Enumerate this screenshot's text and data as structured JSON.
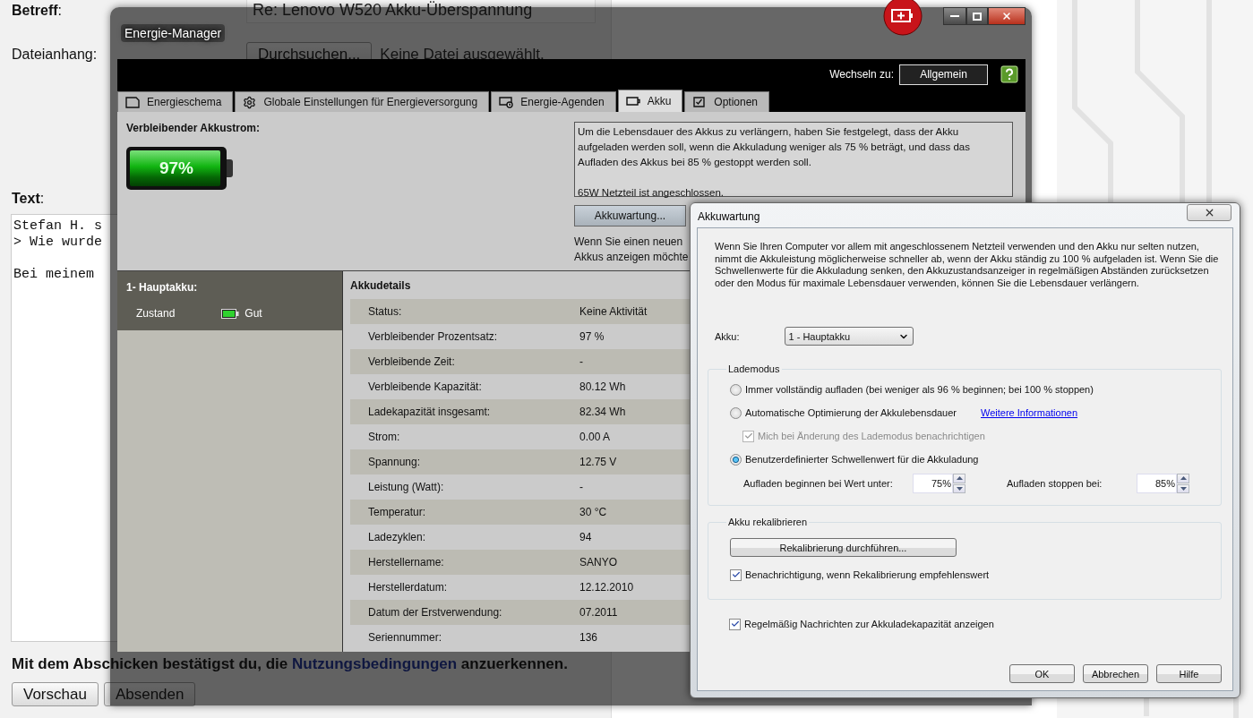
{
  "web_form": {
    "subject": {
      "label": "**Betreff**:",
      "value": "Re: Lenovo W520 Akku-Überspannung"
    },
    "attachment": {
      "label": "Dateianhang:",
      "button": "Durchsuchen...",
      "status": "Keine Datei ausgewählt."
    },
    "message": {
      "label": "**Text**:",
      "value": "Stefan H. s\n> Wie wurde\n\nBei meinem"
    },
    "notice": {
      "before": "Mit dem Abschicken bestätigst du, die ",
      "link": "Nutzungsbedingungen",
      "after": " anzuerkennen."
    },
    "buttons": [
      "Vorschau",
      "Absenden"
    ]
  },
  "energy_manager": {
    "title": "Energie-Manager",
    "switch_label": "Wechseln zu:",
    "switch_button": "Allgemein",
    "tabs": [
      {
        "label": "Energieschema",
        "selected": false
      },
      {
        "label": "Globale Einstellungen für Energieversorgung",
        "selected": false
      },
      {
        "label": "Energie-Agenden",
        "selected": false
      },
      {
        "label": "Akku",
        "selected": true
      },
      {
        "label": "Optionen",
        "selected": false
      }
    ],
    "remaining_label": "Verbleibender Akkustrom:",
    "battery": {
      "reading": "97%",
      "level": 0.97
    },
    "info": "Um die Lebensdauer des Akkus zu verlängern, haben Sie festgelegt, dass der Akku aufgeladen werden soll, wenn die Akkuladung weniger als 75 % beträgt, und dass das Aufladen des Akkus bei 85 % gestoppt werden soll.",
    "adapter": "65W Netzteil ist angeschlossen.",
    "maintenance_button": "Akkuwartung...",
    "hint_lines": [
      "Wenn Sie einen neuen",
      "Akkus anzeigen möchte"
    ],
    "battery_list": {
      "title": "1- Hauptakku:",
      "state_label": "Zustand",
      "state": "Gut"
    },
    "details": {
      "title": "Akkudetails",
      "rows": [
        {
          "label": "Status:",
          "value": "Keine Aktivität"
        },
        {
          "label": "Verbleibender Prozentsatz:",
          "value": "97 %"
        },
        {
          "label": "Verbleibende Zeit:",
          "value": "-"
        },
        {
          "label": "Verbleibende Kapazität:",
          "value": "80.12 Wh"
        },
        {
          "label": "Ladekapazität insgesamt:",
          "value": "82.34 Wh"
        },
        {
          "label": "Strom:",
          "value": "0.00 A"
        },
        {
          "label": "Spannung:",
          "value": "12.75 V"
        },
        {
          "label": "Leistung (Watt):",
          "value": "-"
        },
        {
          "label": "Temperatur:",
          "value": "30 °C"
        },
        {
          "label": "Ladezyklen:",
          "value": "94"
        },
        {
          "label": "Herstellername:",
          "value": "SANYO"
        },
        {
          "label": "Herstellerdatum:",
          "value": "12.12.2010"
        },
        {
          "label": "Datum der Erstverwendung:",
          "value": "07.2011"
        },
        {
          "label": "Seriennummer:",
          "value": "136"
        }
      ]
    }
  },
  "dialog": {
    "title": "Akkuwartung",
    "intro": "Wenn Sie Ihren Computer vor allem mit angeschlossenem Netzteil verwenden und den Akku nur selten nutzen, nimmt die Akkuleistung möglicherweise schneller ab, wenn der Akku ständig zu 100 % aufgeladen ist. Wenn Sie die Schwellenwerte für die Akkuladung senken, den Akkuzustandsanzeiger in regelmäßigen Abständen zurücksetzen oder den Modus für maximale Lebensdauer verwenden, können Sie die Lebensdauer verlängern.",
    "battery_label": "Akku:",
    "battery_select": "1 - Hauptakku",
    "charge_mode": {
      "title": "Lademodus",
      "options": [
        {
          "kind": "radio",
          "label": "Immer vollständig aufladen (bei weniger als 96 % beginnen; bei 100 % stoppen)",
          "selected": false,
          "disabled": false
        },
        {
          "kind": "radio",
          "label": "Automatische Optimierung der Akkulebensdauer",
          "selected": false,
          "disabled": false,
          "link": "Weitere Informationen"
        },
        {
          "kind": "checkbox",
          "label": "Mich bei Änderung des Lademodus benachrichtigen",
          "checked": true,
          "disabled": true
        },
        {
          "kind": "radio",
          "label": "Benutzerdefinierter Schwellenwert für die Akkuladung",
          "selected": true,
          "disabled": false
        }
      ],
      "thresholds": [
        {
          "label": "Aufladen beginnen bei Wert unter:",
          "value": "75%"
        },
        {
          "label": "Aufladen stoppen bei:",
          "value": "85%"
        }
      ]
    },
    "recalibrate": {
      "title": "Akku rekalibrieren",
      "button": "Rekalibrierung durchführen...",
      "notify": {
        "label": "Benachrichtigung, wenn Rekalibrierung empfehlenswert",
        "checked": true
      }
    },
    "capacity_messages": {
      "label": "Regelmäßig Nachrichten zur Akkuladekapazität anzeigen",
      "checked": true
    },
    "buttons": [
      "OK",
      "Abbrechen",
      "Hilfe"
    ]
  }
}
